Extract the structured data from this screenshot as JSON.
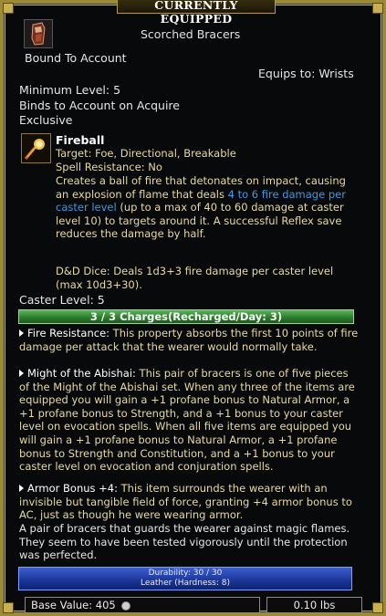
{
  "window": {
    "title": "CURRENTLY EQUIPPED"
  },
  "item": {
    "name": "Scorched Bracers",
    "bound": "Bound To Account",
    "equips_to": "Equips to: Wrists",
    "min_level": "Minimum Level: 5",
    "binds": "Binds to Account on Acquire",
    "exclusive": "Exclusive",
    "icon": "bracers-icon"
  },
  "spell": {
    "icon": "fireball-icon",
    "name": "Fireball",
    "target": "Target: Foe, Directional, Breakable",
    "resistance": "Spell Resistance: No",
    "desc_1": "Creates a ball of fire that detonates on impact, causing an explosion of flame that deals ",
    "desc_highlight": "4 to 6 fire damage per caster level",
    "desc_2": " (up to a max of 40 to 60 damage at caster level 10) to targets around it. A successful Reflex save reduces the damage by half.",
    "dnd_dice": "D&D Dice: Deals 1d3+3 fire damage per caster level (max 10d3+30).",
    "caster_level": "Caster Level: 5",
    "charges": "3 / 3 Charges(Recharged/Day: 3)"
  },
  "effects": [
    {
      "label": "Fire Resistance:",
      "text": " This property absorbs the first 10 points of fire damage per attack that the wearer would normally take."
    },
    {
      "label": "Might of the Abishai:",
      "text": " This pair of bracers is one of five pieces of the Might of the Abishai set. When any three of the items are equipped you will gain a +1 profane bonus to Natural Armor, a +1 profane bonus to Strength, and a +1 bonus to your caster level on evocation spells. When all five items are equipped you will gain a +1 profane bonus to Natural Armor, a +1 profane bonus to Strength and Constitution, and a +1 bonus to your caster level on evocation and conjuration spells."
    },
    {
      "label": "Armor Bonus +4:",
      "text": " This item surrounds the wearer with an invisible but tangible field of force, granting +4 armor bonus to AC, just as though he were wearing armor."
    }
  ],
  "lore": "A pair of bracers that guards the wearer against magic flames. They seem to have been tested vigorously until the protection was perfected.",
  "durability": {
    "text": "Durability: 30 / 30",
    "material": "Leather (Hardness: 8)",
    "fraction": 1.0
  },
  "footer": {
    "base_value": "Base Value: 405",
    "weight": "0.10 lbs",
    "coin_icon": "coin-icon"
  },
  "colors": {
    "frame": "#9b8a3a",
    "highlight": "#3d9ae0",
    "charges_bar": "#2d7e2d",
    "durability_bar": "#1a3595",
    "effect_text": "#e8d9a0"
  }
}
